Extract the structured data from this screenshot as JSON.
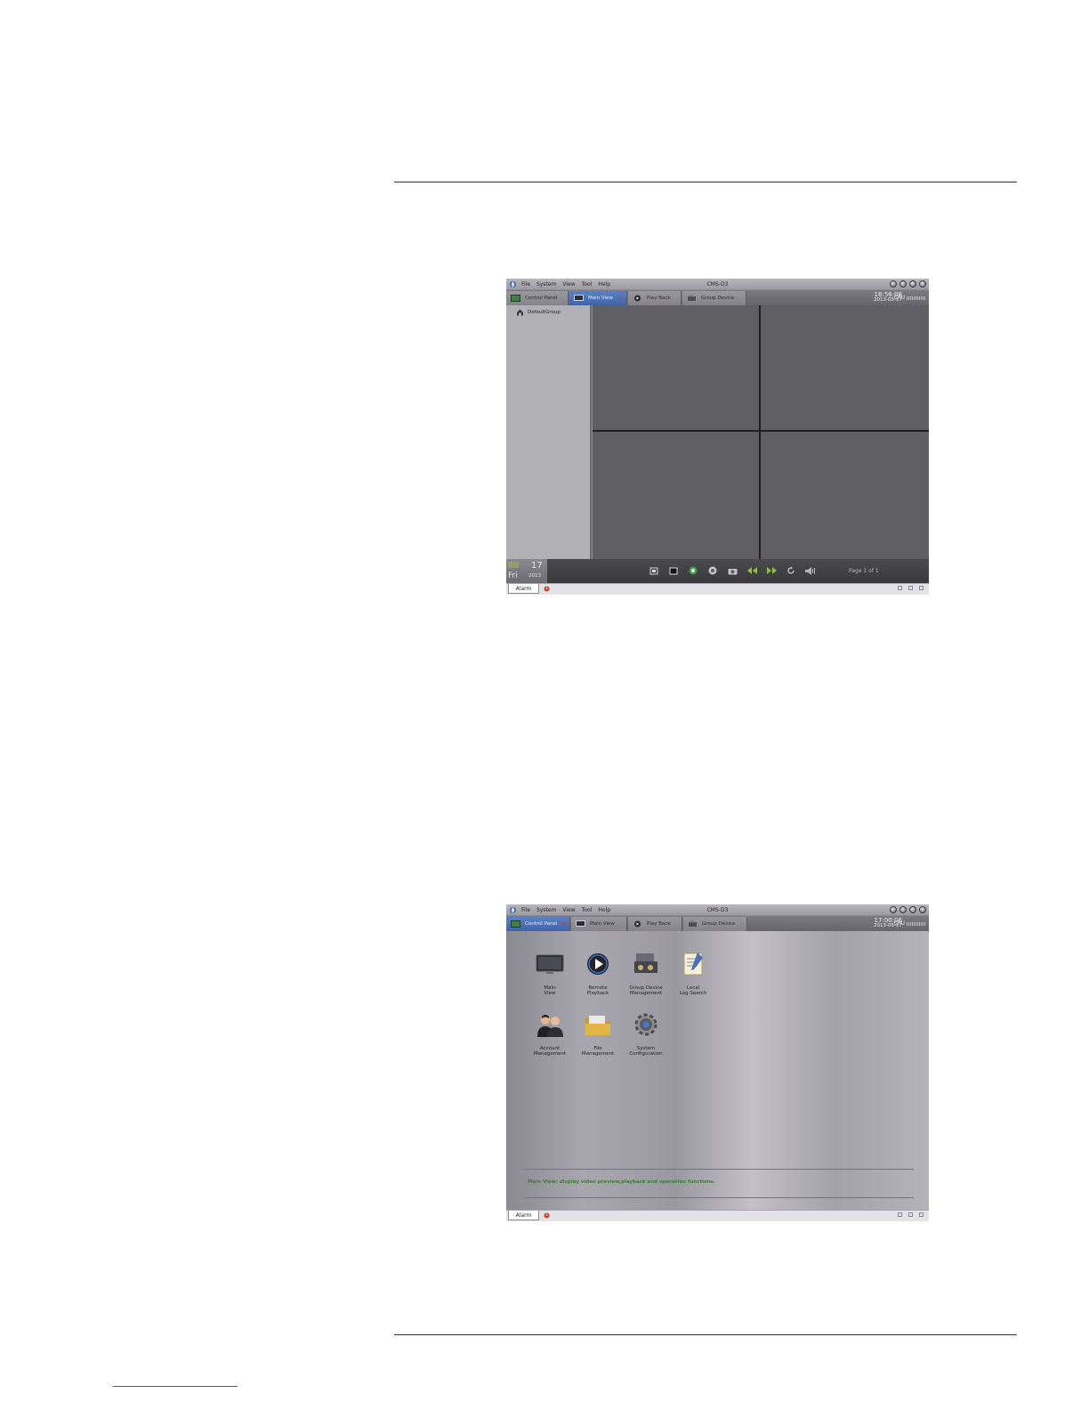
{
  "screen1": {
    "menu": [
      "File",
      "System",
      "View",
      "Tool",
      "Help"
    ],
    "app_title": "CMS-D3",
    "tabs": [
      {
        "label": "Control Panel",
        "closable": false,
        "active": false
      },
      {
        "label": "Main View",
        "closable": true,
        "active": true
      },
      {
        "label": "Play Back",
        "closable": false,
        "active": false
      },
      {
        "label": "Group Device",
        "closable": false,
        "active": false
      }
    ],
    "time": "16:56:08",
    "date": "2013-05-17",
    "cpu_label": "CPU",
    "tree_root": "DefaultGroup",
    "calendar": {
      "day": "17",
      "weekday": "Fri",
      "year": "2013"
    },
    "pager": "Page 1 of 1",
    "alarm_tab": "Alarm"
  },
  "screen2": {
    "menu": [
      "File",
      "System",
      "View",
      "Tool",
      "Help"
    ],
    "app_title": "CMS-D3",
    "tabs": [
      {
        "label": "Control Panel",
        "closable": true,
        "active": true
      },
      {
        "label": "Main View",
        "closable": false,
        "active": false
      },
      {
        "label": "Play Back",
        "closable": false,
        "active": false
      },
      {
        "label": "Group Device",
        "closable": false,
        "active": false
      }
    ],
    "time": "17:00:06",
    "date": "2013-05-17",
    "cpu_label": "CPU",
    "apps": [
      {
        "line1": "Main",
        "line2": "View",
        "icon": "monitor-icon"
      },
      {
        "line1": "Remote",
        "line2": "Playback",
        "icon": "playback-icon"
      },
      {
        "line1": "Group Device",
        "line2": "Management",
        "icon": "device-management-icon"
      },
      {
        "line1": "Local",
        "line2": "Log Search",
        "icon": "log-search-icon"
      },
      {
        "line1": "Account",
        "line2": "Management",
        "icon": "account-icon"
      },
      {
        "line1": "File",
        "line2": "Management",
        "icon": "folder-icon"
      },
      {
        "line1": "System",
        "line2": "Configuration",
        "icon": "gear-icon"
      }
    ],
    "hint": "Main View: display video preview,playback and operation functions.",
    "alarm_tab": "Alarm"
  },
  "colors": {
    "active_tab": "#4a6fb5",
    "cpu_meter": "#b8d84c",
    "hint_text": "#3e7b3a",
    "close_x": "#d62b2b"
  }
}
